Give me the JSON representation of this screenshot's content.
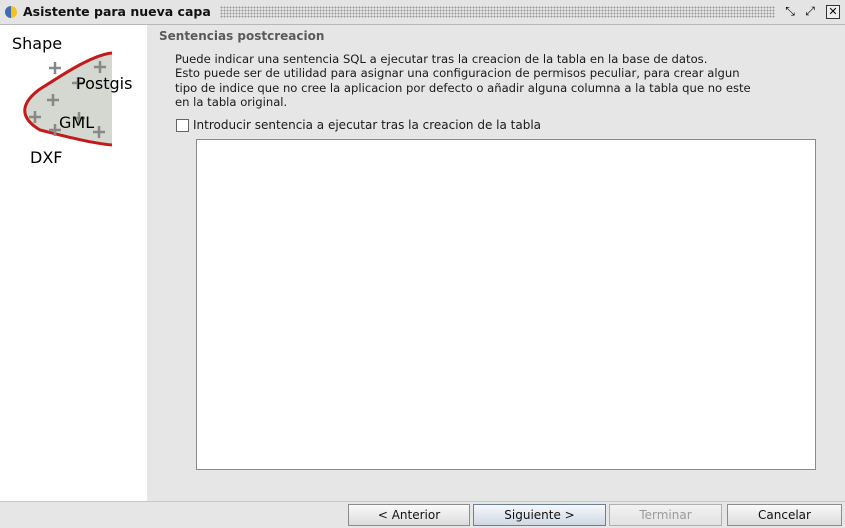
{
  "window": {
    "title": "Asistente para nueva capa",
    "icons": [
      "minimize-restore-icon",
      "maximize-icon",
      "close-icon"
    ]
  },
  "logo": {
    "labels": [
      "Shape",
      "Postgis",
      "GML",
      "DXF"
    ]
  },
  "section": {
    "title": "Sentencias postcreacion",
    "description_lines": [
      "Puede indicar una sentencia SQL a ejecutar tras la creacion de la tabla en la base de datos.",
      "Esto puede ser de utilidad para asignar una configuracion de permisos peculiar, para crear algun",
      "tipo de indice que no cree la aplicacion por defecto o añadir alguna columna a la tabla que no este",
      "en la tabla original."
    ],
    "checkbox_label": "Introducir sentencia a ejecutar tras la creacion de la tabla",
    "checkbox_checked": false,
    "sql_text": ""
  },
  "buttons": {
    "prev_label": "< Anterior",
    "next_label": "Siguiente >",
    "finish_label": "Terminar",
    "cancel_label": "Cancelar"
  }
}
